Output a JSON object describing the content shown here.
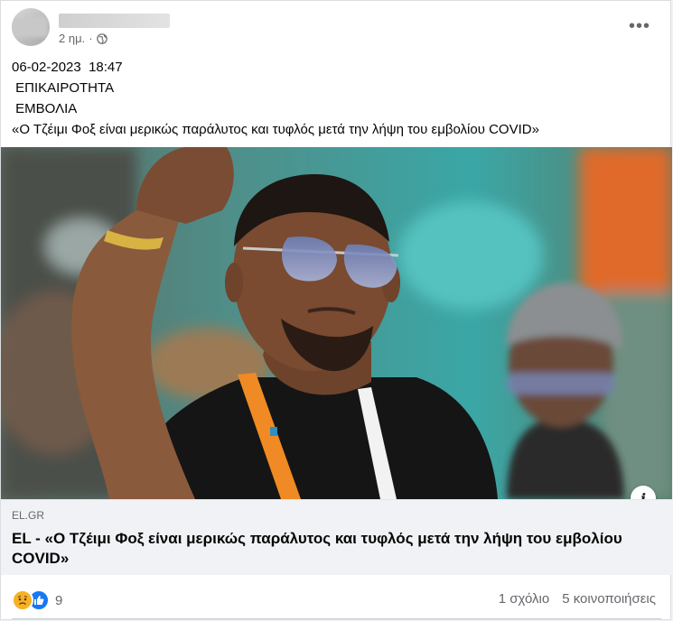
{
  "post": {
    "author_name": "",
    "time": "2 ημ.",
    "separator": "·",
    "privacy_icon": "globe-icon",
    "more_icon": "more-options-icon",
    "more_label": "•••",
    "text_lines": [
      "06-02-2023  18:47",
      " ΕΠΙΚΑΙΡΟΤΗΤΑ",
      " ΕΜΒΟΛΙΑ",
      "«Ο Τζέιμι Φοξ είναι μερικώς παράλυτος και τυφλός μετά την λήψη του εμβολίου COVID»"
    ]
  },
  "link": {
    "domain": "EL.GR",
    "title": "EL - «Ο Τζέιμι Φοξ είναι μερικώς παράλυτος και τυφλός μετά την λήψη του εμβολίου COVID»",
    "info_label": "i"
  },
  "footer": {
    "reaction_icons": [
      "sad-reaction-icon",
      "like-reaction-icon"
    ],
    "reaction_count": "9",
    "comments": "1 σχόλιο",
    "shares": "5 κοινοποιήσεις"
  },
  "colors": {
    "link_box_bg": "#f0f2f5",
    "like_blue": "#1877f2",
    "sad_yellow": "#f7b125",
    "meta_gray": "#65676b"
  }
}
